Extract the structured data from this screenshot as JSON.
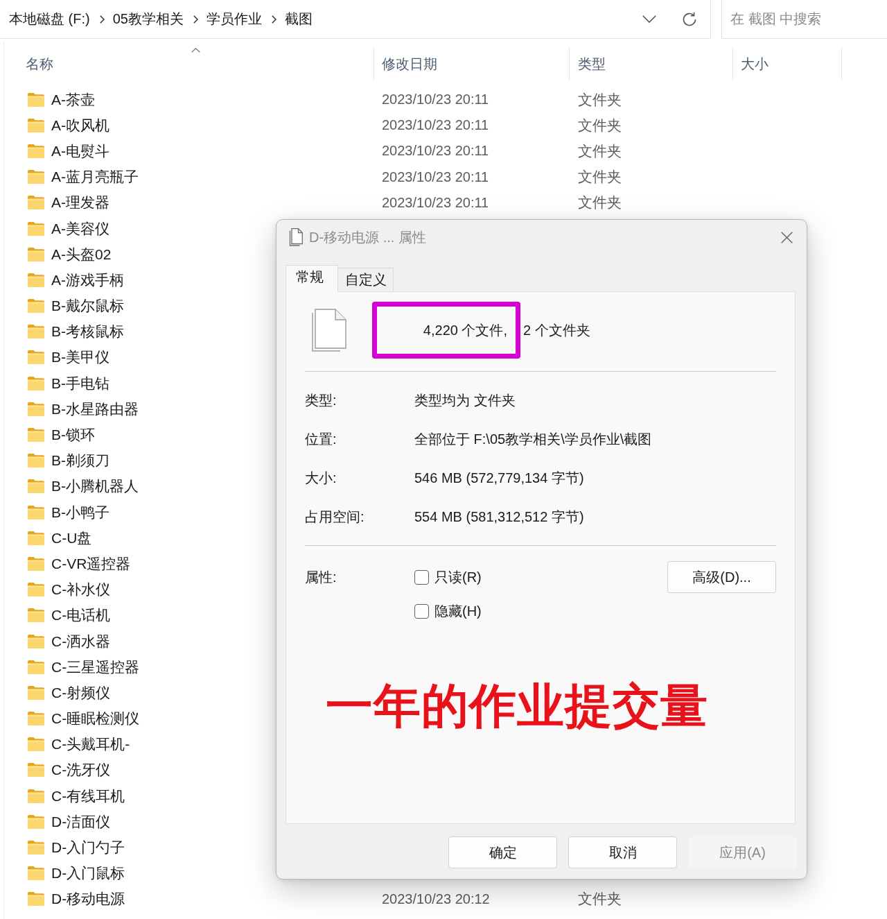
{
  "address_bar": {
    "breadcrumbs": [
      "本地磁盘 (F:)",
      "05教学相关",
      "学员作业",
      "截图"
    ]
  },
  "search": {
    "placeholder": "在 截图 中搜索"
  },
  "columns": [
    {
      "label": "名称",
      "sorted": true
    },
    {
      "label": "修改日期",
      "sorted": false
    },
    {
      "label": "类型",
      "sorted": false
    },
    {
      "label": "大小",
      "sorted": false
    }
  ],
  "rows": [
    {
      "name": "A-茶壶",
      "date": "2023/10/23 20:11",
      "type": "文件夹"
    },
    {
      "name": "A-吹风机",
      "date": "2023/10/23 20:11",
      "type": "文件夹"
    },
    {
      "name": "A-电熨斗",
      "date": "2023/10/23 20:11",
      "type": "文件夹"
    },
    {
      "name": "A-蓝月亮瓶子",
      "date": "2023/10/23 20:11",
      "type": "文件夹"
    },
    {
      "name": "A-理发器",
      "date": "2023/10/23 20:11",
      "type": "文件夹"
    },
    {
      "name": "A-美容仪"
    },
    {
      "name": "A-头盔02"
    },
    {
      "name": "A-游戏手柄"
    },
    {
      "name": "B-戴尔鼠标"
    },
    {
      "name": "B-考核鼠标"
    },
    {
      "name": "B-美甲仪"
    },
    {
      "name": "B-手电钻"
    },
    {
      "name": "B-水星路由器"
    },
    {
      "name": "B-锁环"
    },
    {
      "name": "B-剃须刀"
    },
    {
      "name": "B-小腾机器人"
    },
    {
      "name": "B-小鸭子"
    },
    {
      "name": "C-U盘"
    },
    {
      "name": "C-VR遥控器"
    },
    {
      "name": "C-补水仪"
    },
    {
      "name": "C-电话机"
    },
    {
      "name": "C-洒水器"
    },
    {
      "name": "C-三星遥控器"
    },
    {
      "name": "C-射频仪"
    },
    {
      "name": "C-睡眠检测仪"
    },
    {
      "name": "C-头戴耳机-"
    },
    {
      "name": "C-洗牙仪"
    },
    {
      "name": "C-有线耳机"
    },
    {
      "name": "D-洁面仪"
    },
    {
      "name": "D-入门勺子"
    },
    {
      "name": "D-入门鼠标"
    },
    {
      "name": "D-移动电源",
      "date": "2023/10/23 20:12",
      "type": "文件夹"
    }
  ],
  "dialog": {
    "title": "D-移动电源 ... 属性",
    "tabs": [
      {
        "label": "常规",
        "selected": true
      },
      {
        "label": "自定义",
        "selected": false
      }
    ],
    "summary": {
      "files": "4,220 个文件,",
      "folders": "2 个文件夹"
    },
    "properties": [
      {
        "label": "类型:",
        "value": "类型均为 文件夹"
      },
      {
        "label": "位置:",
        "value": "全部位于 F:\\05教学相关\\学员作业\\截图"
      },
      {
        "label": "大小:",
        "value": "546 MB (572,779,134 字节)"
      },
      {
        "label": "占用空间:",
        "value": "554 MB (581,312,512 字节)"
      }
    ],
    "attributes": {
      "label": "属性:",
      "checkboxes": [
        {
          "label": "只读(R)",
          "checked": false
        },
        {
          "label": "隐藏(H)",
          "checked": false
        }
      ],
      "advanced_button": "高级(D)..."
    },
    "buttons": [
      {
        "label": "确定",
        "disabled": false
      },
      {
        "label": "取消",
        "disabled": false
      },
      {
        "label": "应用(A)",
        "disabled": true
      }
    ]
  },
  "annotation": {
    "text": "一年的作业提交量"
  }
}
